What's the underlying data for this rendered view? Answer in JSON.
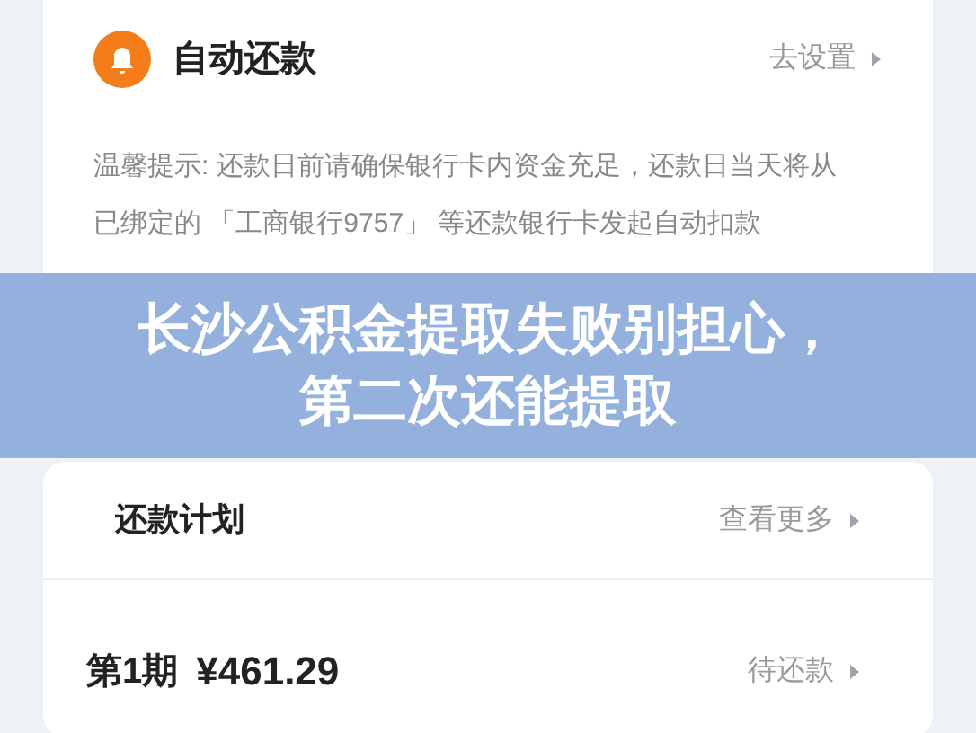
{
  "auto_repay": {
    "title": "自动还款",
    "action": "去设置",
    "tip_lines": [
      "温馨提示: 还款日前请确保银行卡内资金充足，还款日当天将从",
      "已绑定的 「工商银行9757」 等还款银行卡发起自动扣款"
    ]
  },
  "banner": {
    "lines": [
      "长沙公积金提取失败别担心，",
      "第二次还能提取"
    ]
  },
  "plan": {
    "title": "还款计划",
    "action": "查看更多",
    "installments": [
      {
        "period": "第1期",
        "amount": "¥461.29",
        "status": "待还款"
      }
    ]
  }
}
